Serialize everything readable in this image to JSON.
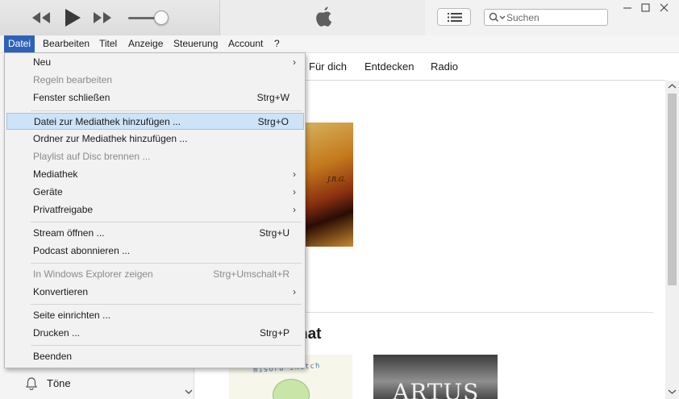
{
  "window": {
    "search_placeholder": "Suchen"
  },
  "icons": {
    "player": [
      "rewind-icon",
      "play-icon",
      "fast-forward-icon"
    ],
    "lcd": "apple-logo-icon",
    "list_view": "list-icon",
    "search": "search-icon",
    "window_controls": [
      "minimize-icon",
      "maximize-icon",
      "close-icon"
    ]
  },
  "menubar": {
    "items": [
      "Datei",
      "Bearbeiten",
      "Titel",
      "Anzeige",
      "Steuerung",
      "Account",
      "?"
    ],
    "active_index": 0
  },
  "file_menu": {
    "items": [
      {
        "label": "Neu",
        "shortcut": "",
        "submenu": true,
        "enabled": true
      },
      {
        "label": "Regeln bearbeiten",
        "shortcut": "",
        "submenu": false,
        "enabled": false
      },
      {
        "label": "Fenster schließen",
        "shortcut": "Strg+W",
        "submenu": false,
        "enabled": true
      },
      {
        "label": "Datei zur Mediathek hinzufügen ...",
        "shortcut": "Strg+O",
        "submenu": false,
        "enabled": true,
        "highlighted": true
      },
      {
        "label": "Ordner zur Mediathek hinzufügen ...",
        "shortcut": "",
        "submenu": false,
        "enabled": true
      },
      {
        "label": "Playlist auf Disc brennen ...",
        "shortcut": "",
        "submenu": false,
        "enabled": false
      },
      {
        "label": "Mediathek",
        "shortcut": "",
        "submenu": true,
        "enabled": true
      },
      {
        "label": "Geräte",
        "shortcut": "",
        "submenu": true,
        "enabled": true
      },
      {
        "label": "Privatfreigabe",
        "shortcut": "",
        "submenu": true,
        "enabled": true
      },
      {
        "label": "Stream öffnen ...",
        "shortcut": "Strg+U",
        "submenu": false,
        "enabled": true
      },
      {
        "label": "Podcast abonnieren ...",
        "shortcut": "",
        "submenu": false,
        "enabled": true
      },
      {
        "label": "In Windows Explorer zeigen",
        "shortcut": "Strg+Umschalt+R",
        "submenu": false,
        "enabled": false
      },
      {
        "label": "Konvertieren",
        "shortcut": "",
        "submenu": true,
        "enabled": true
      },
      {
        "label": "Seite einrichten ...",
        "shortcut": "",
        "submenu": false,
        "enabled": true
      },
      {
        "label": "Drucken ...",
        "shortcut": "Strg+P",
        "submenu": false,
        "enabled": true
      },
      {
        "label": "Beenden",
        "shortcut": "",
        "submenu": false,
        "enabled": true
      }
    ]
  },
  "nav_tabs": [
    "Für dich",
    "Entdecken",
    "Radio"
  ],
  "sidebar": {
    "visible_item": {
      "label": "Töne",
      "icon": "bell-icon"
    }
  },
  "content": {
    "section_heading_fragment": "nat",
    "album1_text": "J.R.G.",
    "album2_text": "misora sketch",
    "album3_text": "ARTUS"
  },
  "colors": {
    "menu_active": "#2e62b8",
    "menu_highlight": "#cde3f7",
    "disabled_text": "#8a8a8a"
  }
}
